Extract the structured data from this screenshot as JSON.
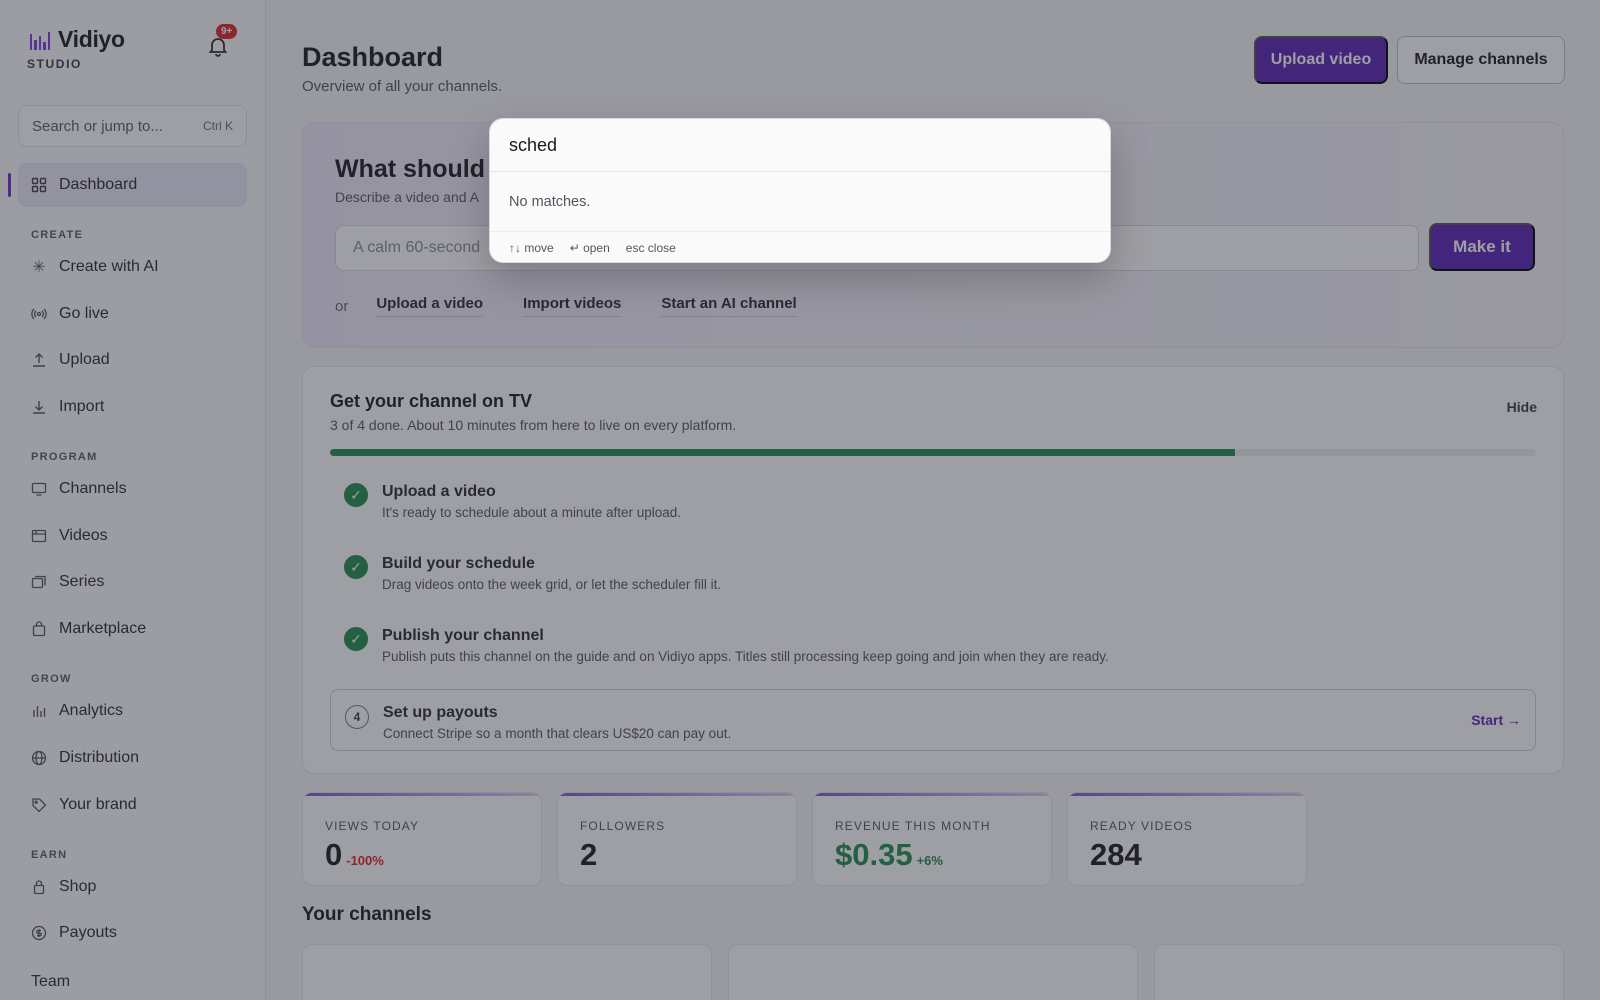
{
  "sidebar": {
    "brand_name": "Vidiyo",
    "brand_sub": "STUDIO",
    "notifications_badge": "9+",
    "search_placeholder": "Search or jump to...",
    "search_shortcut": "Ctrl K",
    "dashboard_label": "Dashboard",
    "sections": {
      "create": "CREATE",
      "program": "PROGRAM",
      "grow": "GROW",
      "earn": "EARN"
    },
    "items": {
      "create_ai": "Create with AI",
      "go_live": "Go live",
      "upload": "Upload",
      "import": "Import",
      "channels": "Channels",
      "videos": "Videos",
      "series": "Series",
      "marketplace": "Marketplace",
      "analytics": "Analytics",
      "distribution": "Distribution",
      "brand": "Your brand",
      "shop": "Shop",
      "payouts": "Payouts"
    },
    "team_label": "Team"
  },
  "header": {
    "title": "Dashboard",
    "subtitle": "Overview of all your channels.",
    "upload_button": "Upload video",
    "manage_button": "Manage channels"
  },
  "create": {
    "title": "What should V",
    "desc": "Describe a video and A",
    "prompt_placeholder": "A calm 60-second",
    "make_button": "Make it",
    "or": "or",
    "link_upload": "Upload a video",
    "link_import": "Import videos",
    "link_ai_channel": "Start an AI channel"
  },
  "onboarding": {
    "title": "Get your channel on TV",
    "subtitle": "3 of 4 done. About 10 minutes from here to live on every platform.",
    "hide": "Hide",
    "progress": 0.75,
    "steps": [
      {
        "title": "Upload a video",
        "desc": "It's ready to schedule about a minute after upload.",
        "done": true
      },
      {
        "title": "Build your schedule",
        "desc": "Drag videos onto the week grid, or let the scheduler fill it.",
        "done": true
      },
      {
        "title": "Publish your channel",
        "desc": "Publish puts this channel on the guide and on Vidiyo apps. Titles still processing keep going and join when they are ready.",
        "done": true
      },
      {
        "title": "Set up payouts",
        "desc": "Connect Stripe so a month that clears US$20 can pay out.",
        "done": false,
        "number": "4",
        "action": "Start →"
      }
    ]
  },
  "stats": [
    {
      "label": "VIEWS TODAY",
      "value": "0",
      "delta": "-100%"
    },
    {
      "label": "FOLLOWERS",
      "value": "2",
      "delta": ""
    },
    {
      "label": "REVENUE THIS MONTH",
      "value": "$0.35",
      "delta": "+6%"
    },
    {
      "label": "READY VIDEOS",
      "value": "284",
      "delta": ""
    }
  ],
  "channels_title": "Your channels",
  "palette": {
    "query": "sched",
    "empty": "No matches.",
    "hint_move": "↑↓ move",
    "hint_open": "↵ open",
    "hint_close": "esc close"
  },
  "colors": {
    "accent": "#5b21b6",
    "success": "#1f8a4c",
    "danger": "#dc2626"
  }
}
